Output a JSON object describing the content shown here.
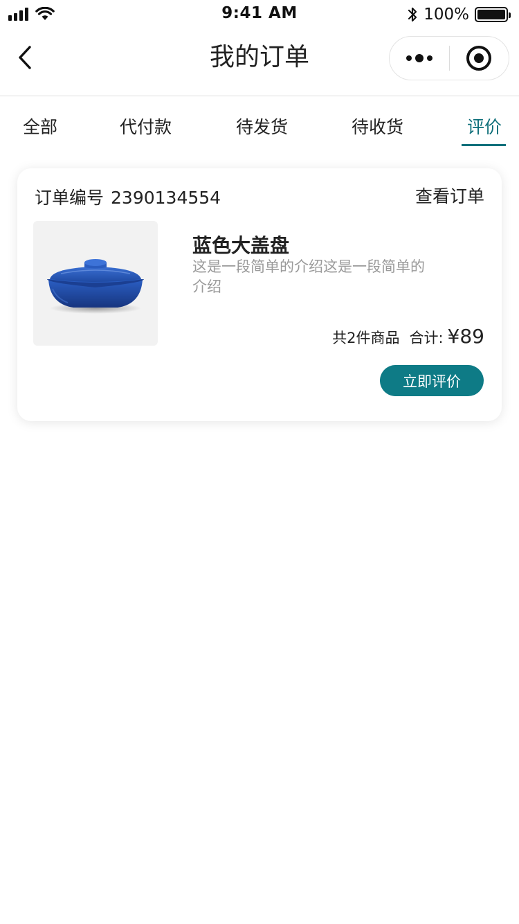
{
  "status_bar": {
    "time": "9:41 AM",
    "battery_percent": "100%",
    "battery_level": 1.0,
    "icons": [
      "signal-icon",
      "wifi-icon",
      "bluetooth-icon",
      "battery-icon"
    ]
  },
  "nav": {
    "title": "我的订单",
    "icons": [
      "back-chevron-icon",
      "more-dots-icon",
      "target-icon"
    ]
  },
  "tabs": {
    "items": [
      {
        "label": "全部"
      },
      {
        "label": "代付款"
      },
      {
        "label": "待发货"
      },
      {
        "label": "待收货"
      },
      {
        "label": "评价"
      }
    ],
    "active_label": "评价"
  },
  "order": {
    "number_label": "订单编号",
    "number": "2390134554",
    "view_label": "查看订单",
    "product": {
      "name": "蓝色大盖盘",
      "description": "这是一段简单的介绍这是一段简单的介绍",
      "image_icon": "blue-casserole-dish-image"
    },
    "count_text": "共2件商品",
    "total_label": "合计:",
    "total": "¥89",
    "action_label": "立即评价"
  },
  "colors": {
    "accent": "#0e6f7a",
    "button": "#0e7b86",
    "text": "#222222",
    "muted": "#9a9a9a",
    "dish_blue": "#1f4fb0"
  }
}
